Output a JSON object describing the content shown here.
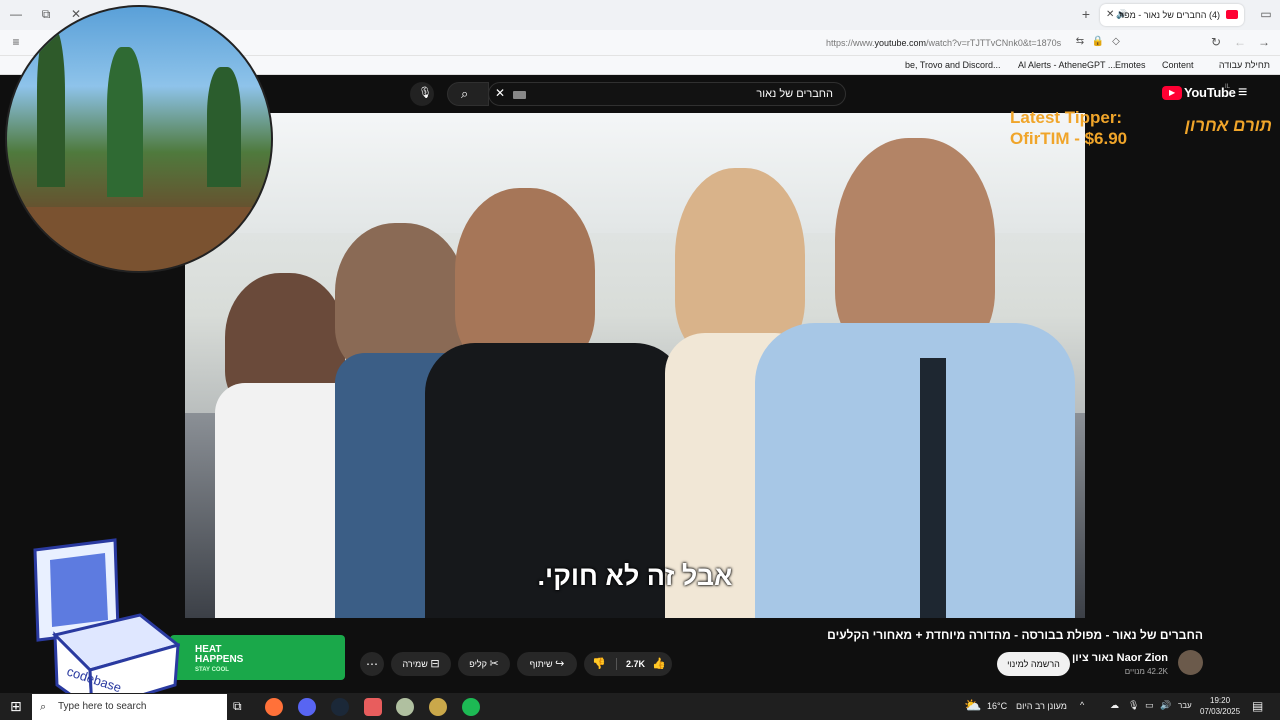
{
  "browser": {
    "tab": {
      "title": "(4) החברים של נאור - מפולת בבורסה - מהדורה מיוחדת"
    },
    "address": {
      "prefix": "https://www.",
      "domain": "youtube.com",
      "path": "/watch?v=rTJTTvCNnk0&t=1870s"
    },
    "bookmarks": [
      {
        "label": "תחילת עבודה"
      },
      {
        "label": "Content"
      },
      {
        "label": "Emotes"
      },
      {
        "label": "Al Alerts - AtheneGPT ..."
      },
      {
        "label": "be, Trovo and Discord..."
      }
    ]
  },
  "youtube": {
    "logo": "YouTube",
    "logo_region": "IL",
    "search_value": "החברים של נאור"
  },
  "video": {
    "subtitle": "אבל זה לא חוקי.",
    "title": "החברים של נאור - מפולת בבורסה - מהדורה מיוחדת + מאחורי הקלעים",
    "channel": "נאור ציון Naor Zion",
    "subscribers": "42.2K מנויים",
    "subscribe_label": "הרשמה למינוי",
    "likes": "2.7K",
    "share_label": "שיתוף",
    "clip_label": "קליפ",
    "save_label": "שמירה"
  },
  "overlay": {
    "tipper_line1": "Latest Tipper:",
    "tipper_line2": "OfirTIM - $6.90",
    "tipper_he": "תורם אחרון",
    "ad_line1": "HEAT",
    "ad_line2": "HAPPENS",
    "ad_line3": "STAY COOL",
    "codebase": "codebase"
  },
  "taskbar": {
    "search_placeholder": "Type here to search",
    "weather_temp": "16°C",
    "weather_desc": "מעונן רב היום",
    "lang": "עבר",
    "time": "19:20",
    "date": "07/03/2025"
  }
}
